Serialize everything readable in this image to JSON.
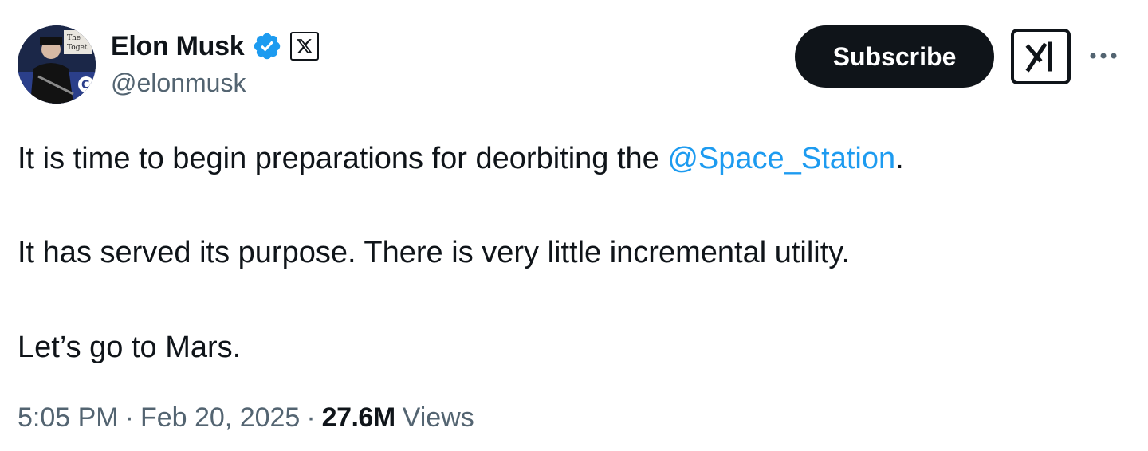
{
  "author": {
    "display_name": "Elon Musk",
    "handle": "@elonmusk",
    "avatar_icon": "profile-photo",
    "verified_icon": "verified-badge-icon",
    "verified_color": "#1d9bf0",
    "affiliation_icon": "x-logo-icon"
  },
  "actions": {
    "subscribe_label": "Subscribe",
    "grok_icon": "grok-icon",
    "more_icon": "more-horizontal-icon"
  },
  "tweet": {
    "line1_prefix": "It is time to begin preparations for deorbiting the ",
    "line1_mention": "@Space_Station",
    "line1_suffix": ".",
    "line2": "It has served its purpose. There is very little incremental utility.",
    "line3": "Let’s go to Mars."
  },
  "meta": {
    "time": "5:05 PM",
    "separator": "·",
    "date": "Feb 20, 2025",
    "views_count": "27.6M",
    "views_label": "Views"
  },
  "colors": {
    "text": "#0f1419",
    "secondary": "#536471",
    "link": "#1d9bf0",
    "button_bg": "#0f1419"
  }
}
